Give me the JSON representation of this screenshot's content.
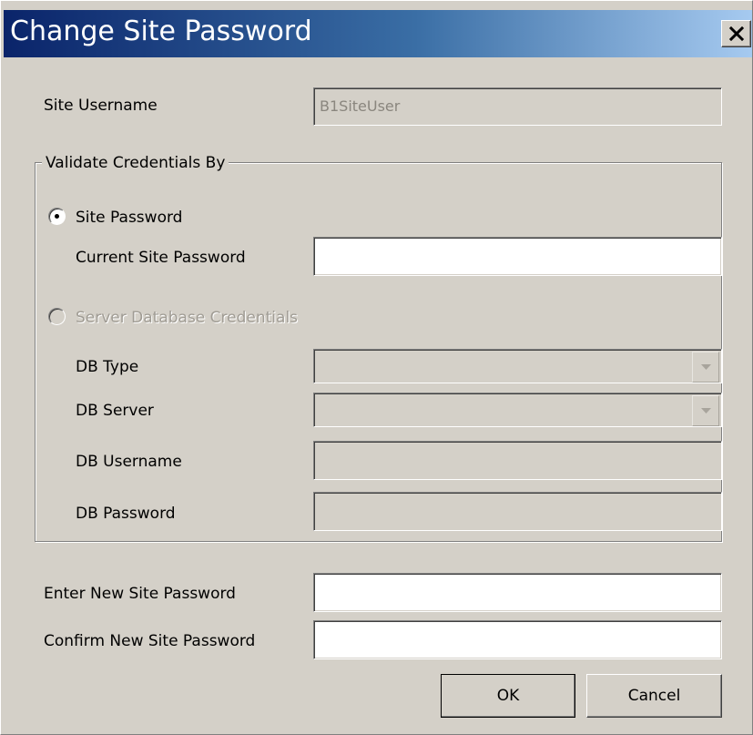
{
  "window": {
    "title": "Change Site Password"
  },
  "site_username": {
    "label": "Site Username",
    "value": "B1SiteUser"
  },
  "validate_group": {
    "legend": "Validate Credentials By",
    "site_password_option": {
      "label": "Site Password",
      "selected": true,
      "current_password_label": "Current Site Password",
      "current_password_value": ""
    },
    "server_db_option": {
      "label": "Server Database Credentials",
      "selected": false,
      "enabled": false,
      "db_type_label": "DB Type",
      "db_type_value": "",
      "db_server_label": "DB Server",
      "db_server_value": "",
      "db_username_label": "DB Username",
      "db_username_value": "",
      "db_password_label": "DB Password",
      "db_password_value": ""
    }
  },
  "new_password": {
    "enter_label": "Enter New Site Password",
    "enter_value": "",
    "confirm_label": "Confirm New Site Password",
    "confirm_value": ""
  },
  "buttons": {
    "ok_label": "OK",
    "cancel_label": "Cancel"
  },
  "icons": {
    "close": "close-icon",
    "dropdown": "chevron-down-icon"
  },
  "colors": {
    "dialog_face": "#d4d0c8",
    "titlebar_start": "#0a246a",
    "titlebar_end": "#a6caf0",
    "disabled_text": "#a09c94"
  }
}
